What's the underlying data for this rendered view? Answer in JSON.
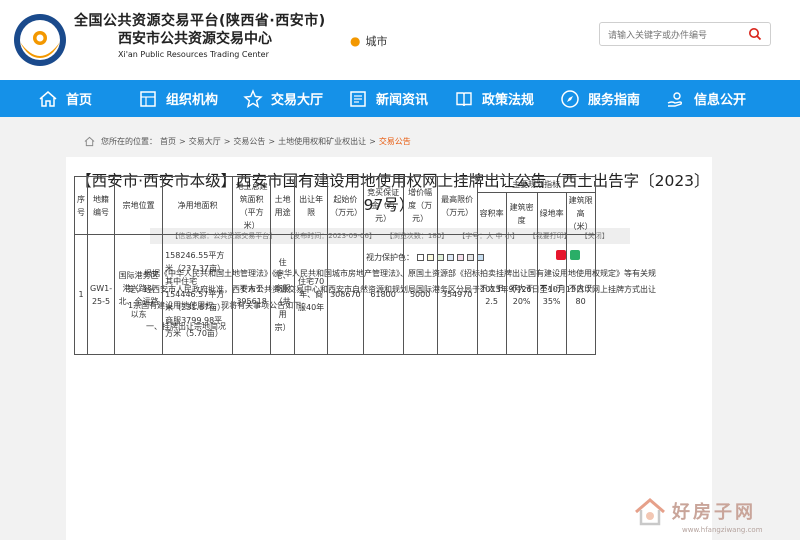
{
  "header": {
    "line1": "全国公共资源交易平台(陕西省·西安市)",
    "line2": "西安市公共资源交易中心",
    "line3": "Xi'an Public Resources Trading Center",
    "city": "城市",
    "search_placeholder": "请输入关键字或办件编号"
  },
  "nav": {
    "items": [
      {
        "label": "首页",
        "icon": "home-icon"
      },
      {
        "label": "组织机构",
        "icon": "org-icon"
      },
      {
        "label": "交易大厅",
        "icon": "star-icon"
      },
      {
        "label": "新闻资讯",
        "icon": "news-icon"
      },
      {
        "label": "政策法规",
        "icon": "book-icon"
      },
      {
        "label": "服务指南",
        "icon": "compass-icon"
      },
      {
        "label": "信息公开",
        "icon": "hand-icon"
      }
    ]
  },
  "breadcrumb": {
    "prefix": "您所在的位置：",
    "items": [
      "首页",
      "交易大厅",
      "交易公告",
      "土地使用权和矿业权出让",
      "交易公告"
    ]
  },
  "article": {
    "title": "【西安市·西安市本级】西安市国有建设用地使用权网上挂牌出让公告（西土出告字〔2023〕97号）",
    "meta": [
      "【信息来源：公共资源交易平台】",
      "【发布时间：2023-09-06】",
      "【浏览次数：180】",
      "【字号：大 中 小】",
      "【我要打印】",
      "【关闭】"
    ],
    "vision_label": "视力保护色：",
    "vision_colors": [
      "#ffffff",
      "#fafae0",
      "#dfefd9",
      "#dde8f6",
      "#f3ddea",
      "#e5e5e5",
      "#c8def0"
    ],
    "paragraph": "根据《中华人民共和国土地管理法》《中华人民共和国城市房地产管理法》、原国土资源部《招标拍卖挂牌出让国有建设用地使用权规定》等有关规定，经西安市人民政府批准，西安市公共资源交易中心和西安市自然资源和规划局国际港务区分局于2023年9月26日至10月13日以网上挂牌方式出让1宗国有建设用地使用权。现将有关事项公告如下：",
    "section": "一、挂牌出让宗地简况"
  },
  "table": {
    "headers": [
      "序号",
      "地籍编号",
      "宗地位置",
      "净用地面积",
      "地上总建筑面积（平方米）",
      "土地用途",
      "出让年限",
      "起始价（万元）",
      "竞买保证金（万元）",
      "增价幅度（万元）",
      "最高限价（万元）"
    ],
    "group_header": "主要规划指标",
    "sub_headers": [
      "容积率",
      "建筑密度",
      "绿地率",
      "建筑限高（米）"
    ],
    "row": {
      "no": "1",
      "code": "GW1-25-5",
      "location": "国际港务区港兴路以北、全运路以东",
      "area": "158246.55平方米（237.37亩），其中住宅154446.57平方米（231.67亩），商服3799.98平方米（5.70亩）",
      "building_area": "不大于395618",
      "use": "住宅、商服（共用宗）",
      "term": "住宅70年、商服40年",
      "start_price": "308670",
      "deposit": "61800",
      "increment": "5000",
      "max_price": "354970",
      "far": "不大于2.5",
      "density": "不大于20%",
      "green": "不小于35%",
      "height": "不大于80"
    }
  },
  "watermark": {
    "text": "好房子网",
    "url": "www.hfangziwang.com"
  }
}
